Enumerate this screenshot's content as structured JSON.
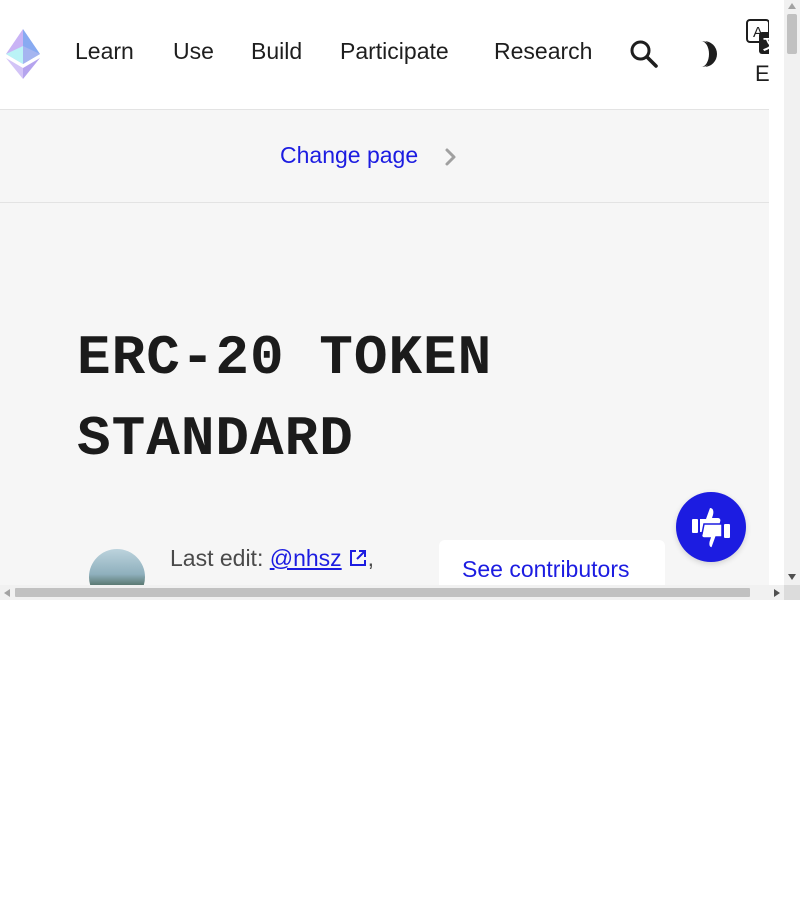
{
  "header": {
    "nav": [
      "Learn",
      "Use",
      "Build",
      "Participate",
      "Research"
    ],
    "language": "EN",
    "icons": {
      "logo": "ethereum-logo-icon",
      "search": "search-icon",
      "theme": "dark-mode-icon",
      "language": "translate-icon"
    }
  },
  "change_page": {
    "label": "Change page",
    "icon": "chevron-right-icon"
  },
  "page": {
    "title": "ERC-20 TOKEN STANDARD"
  },
  "meta": {
    "last_edit_label": "Last edit:",
    "editor": "@nhsz",
    "separator": ",",
    "contributors_button": "See contributors",
    "icons": {
      "external": "external-link-icon",
      "feedback": "thumbs-feedback-icon"
    }
  },
  "colors": {
    "accent": "#1c1ce1",
    "background": "#f6f6f6",
    "text": "#1b1b1b"
  }
}
